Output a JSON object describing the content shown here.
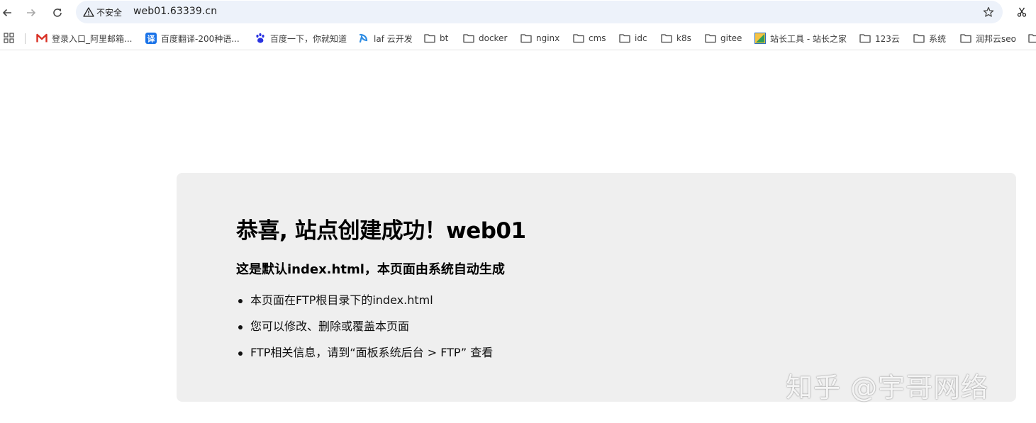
{
  "browser": {
    "security_label": "不安全",
    "url": "web01.63339.cn",
    "icons": {
      "back": "back-arrow-icon",
      "forward": "forward-arrow-icon",
      "reload": "reload-icon",
      "security": "warning-triangle-icon",
      "bookmark_star": "star-icon",
      "extension": "scissors-icon"
    }
  },
  "bookmarks": [
    {
      "label": "登录入口_阿里邮箱...",
      "icon": "gmail-m-icon"
    },
    {
      "label": "百度翻译-200种语...",
      "icon": "translate-icon"
    },
    {
      "label": "百度一下，你就知道",
      "icon": "baidu-paw-icon"
    },
    {
      "label": "laf 云开发",
      "icon": "laf-icon"
    },
    {
      "label": "bt",
      "icon": "folder-icon"
    },
    {
      "label": "docker",
      "icon": "folder-icon"
    },
    {
      "label": "nginx",
      "icon": "folder-icon"
    },
    {
      "label": "cms",
      "icon": "folder-icon"
    },
    {
      "label": "idc",
      "icon": "folder-icon"
    },
    {
      "label": "k8s",
      "icon": "folder-icon"
    },
    {
      "label": "gitee",
      "icon": "folder-icon"
    },
    {
      "label": "站长工具 - 站长之家",
      "icon": "chinaz-icon"
    },
    {
      "label": "123云",
      "icon": "folder-icon"
    },
    {
      "label": "系统",
      "icon": "folder-icon"
    },
    {
      "label": "润邦云seo",
      "icon": "folder-icon"
    }
  ],
  "page": {
    "title": "恭喜, 站点创建成功！web01",
    "subtitle": "这是默认index.html，本页面由系统自动生成",
    "items": [
      "本页面在FTP根目录下的index.html",
      "您可以修改、删除或覆盖本页面",
      "FTP相关信息，请到“面板系统后台 > FTP” 查看"
    ]
  },
  "watermark": "知乎 @宇哥网络",
  "colors": {
    "omnibox_bg": "#edf2fa",
    "card_bg": "#efefef",
    "gmail_red": "#d93025",
    "translate_blue": "#1a73e8",
    "baidu_blue": "#2932e1",
    "laf_blue": "#2f8de4"
  }
}
